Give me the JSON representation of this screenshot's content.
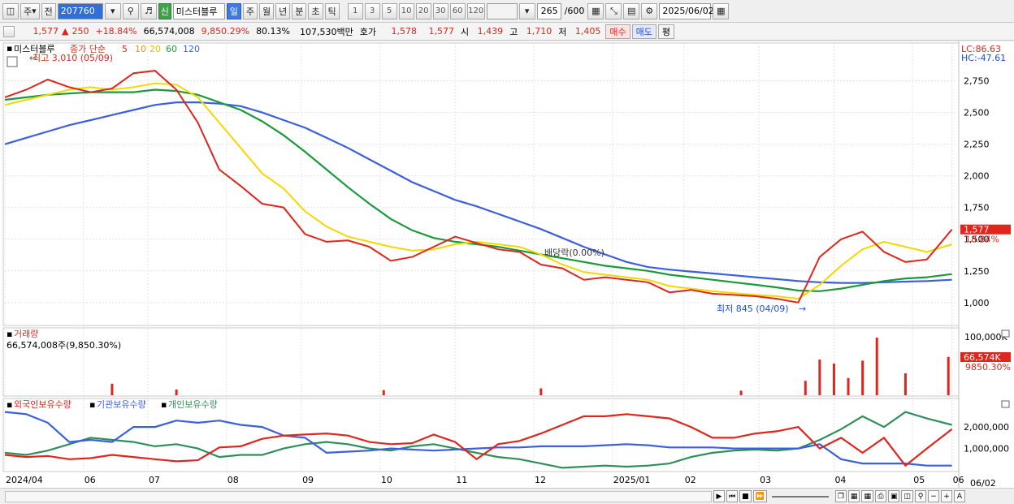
{
  "toolbar": {
    "period_label": "주",
    "prev_label": "전",
    "code": "207760",
    "new_badge": "신",
    "stock_name": "미스터블루",
    "periods": [
      "일",
      "주",
      "월",
      "년",
      "분",
      "초",
      "틱"
    ],
    "active_period": "일",
    "intervals": [
      "1",
      "3",
      "5",
      "10",
      "20",
      "30",
      "60",
      "120"
    ],
    "count": "265",
    "total": "/600",
    "date": "2025/06/02"
  },
  "quote": {
    "price": "1,577",
    "change": "250",
    "rate": "+18.84%",
    "volume": "66,574,008",
    "vol_rate": "9,850.29%",
    "turnover": "80.13%",
    "amount": "107,530백만",
    "bid_label": "호가",
    "bid1": "1,578",
    "bid2": "1,577",
    "open_label": "시",
    "open": "1,439",
    "high_label": "고",
    "high": "1,710",
    "low_label": "저",
    "low": "1,405",
    "buy_label": "매수",
    "sell_label": "매도",
    "avg_label": "평"
  },
  "chart_data": {
    "type": "line",
    "price_panel": {
      "stock_label": "미스터블루",
      "ma_label": "종가 단순",
      "ma_periods": [
        "5",
        "10",
        "20",
        "60",
        "120"
      ],
      "ma_colors": [
        "#e0261c",
        "#f0901e",
        "#f5d800",
        "#1b9a3a",
        "#3b5fe0"
      ],
      "lc": "LC:86.63",
      "hc": "HC:-47.61",
      "high_annotation": "최고 3,010 (05/09)",
      "low_annotation": "최저 845 (04/09)",
      "dividend_annotation": "배당락(0.00%)",
      "last_price": "1,577",
      "last_rate": "18.84%",
      "yticks": [
        "2,750",
        "2,500",
        "2,250",
        "2,000",
        "1,750",
        "1,500",
        "1,250",
        "1,000"
      ],
      "ytick_values": [
        2750,
        2500,
        2250,
        2000,
        1750,
        1500,
        1250,
        1000
      ],
      "ylim": [
        845,
        3010
      ],
      "x": [
        0,
        6,
        12,
        18,
        24,
        30,
        36,
        42,
        48,
        54,
        60,
        66,
        72,
        78,
        84,
        90,
        96,
        102,
        108,
        114,
        120,
        126,
        132,
        138,
        144,
        150,
        156,
        162,
        168,
        174,
        180,
        186,
        192,
        198,
        204,
        210,
        216,
        222,
        228,
        234,
        240,
        246,
        252,
        258,
        265
      ],
      "close": [
        2620,
        2680,
        2760,
        2700,
        2660,
        2690,
        2810,
        2830,
        2680,
        2420,
        2050,
        1920,
        1780,
        1750,
        1540,
        1480,
        1490,
        1440,
        1330,
        1360,
        1440,
        1520,
        1470,
        1420,
        1400,
        1300,
        1270,
        1180,
        1200,
        1180,
        1160,
        1080,
        1100,
        1070,
        1060,
        1050,
        1030,
        1000,
        1360,
        1500,
        1560,
        1400,
        1320,
        1340,
        1577
      ],
      "ma20": [
        2560,
        2600,
        2640,
        2680,
        2700,
        2680,
        2700,
        2730,
        2720,
        2620,
        2420,
        2220,
        2020,
        1900,
        1720,
        1600,
        1520,
        1480,
        1440,
        1410,
        1420,
        1460,
        1480,
        1460,
        1440,
        1380,
        1300,
        1240,
        1220,
        1200,
        1180,
        1130,
        1110,
        1090,
        1075,
        1060,
        1050,
        1030,
        1140,
        1290,
        1420,
        1480,
        1440,
        1400,
        1460
      ],
      "ma60": [
        2600,
        2620,
        2640,
        2650,
        2660,
        2660,
        2660,
        2680,
        2670,
        2640,
        2580,
        2520,
        2430,
        2320,
        2190,
        2050,
        1910,
        1780,
        1660,
        1570,
        1510,
        1480,
        1460,
        1440,
        1410,
        1380,
        1350,
        1320,
        1290,
        1270,
        1250,
        1220,
        1200,
        1180,
        1160,
        1140,
        1120,
        1095,
        1090,
        1110,
        1140,
        1170,
        1190,
        1200,
        1225
      ],
      "ma120": [
        2250,
        2300,
        2350,
        2400,
        2440,
        2480,
        2520,
        2560,
        2580,
        2580,
        2570,
        2550,
        2500,
        2440,
        2380,
        2300,
        2220,
        2130,
        2040,
        1950,
        1880,
        1810,
        1760,
        1700,
        1640,
        1580,
        1510,
        1440,
        1380,
        1320,
        1280,
        1260,
        1245,
        1230,
        1215,
        1200,
        1185,
        1170,
        1160,
        1155,
        1155,
        1160,
        1165,
        1170,
        1180
      ]
    },
    "volume_panel": {
      "title": "거래량",
      "value_label": "66,574,008주(9,850.30%)",
      "ytick": "100,000K",
      "last_value": "66,574K",
      "last_rate": "9850.30%",
      "ylim": [
        0,
        100000
      ],
      "bars": [
        {
          "x": 30,
          "v": 20000
        },
        {
          "x": 48,
          "v": 10000
        },
        {
          "x": 106,
          "v": 9000
        },
        {
          "x": 150,
          "v": 12000
        },
        {
          "x": 206,
          "v": 8000
        },
        {
          "x": 224,
          "v": 25000
        },
        {
          "x": 228,
          "v": 62000
        },
        {
          "x": 232,
          "v": 55000
        },
        {
          "x": 236,
          "v": 30000
        },
        {
          "x": 240,
          "v": 60000
        },
        {
          "x": 244,
          "v": 100000
        },
        {
          "x": 252,
          "v": 38000
        },
        {
          "x": 264,
          "v": 66574
        }
      ]
    },
    "holdings_panel": {
      "legend": [
        "외국인보유수량",
        "기관보유수량",
        "개인보유수량"
      ],
      "legend_colors": [
        "#e0261c",
        "#3b5fe0",
        "#2f8f5a"
      ],
      "yticks": [
        "2,000,000",
        "1,000,000"
      ],
      "ytick_values": [
        2000000,
        1000000
      ],
      "ylim": [
        0,
        2800000
      ],
      "x": [
        0,
        6,
        12,
        18,
        24,
        30,
        36,
        42,
        48,
        54,
        60,
        66,
        72,
        78,
        84,
        90,
        96,
        102,
        108,
        114,
        120,
        126,
        132,
        138,
        144,
        150,
        156,
        162,
        168,
        174,
        180,
        186,
        192,
        198,
        204,
        210,
        216,
        222,
        228,
        234,
        240,
        246,
        252,
        258,
        265
      ],
      "foreign": [
        700,
        600,
        650,
        500,
        550,
        700,
        600,
        500,
        400,
        450,
        1050,
        1100,
        1450,
        1600,
        1650,
        1700,
        1600,
        1300,
        1200,
        1250,
        1650,
        1300,
        500,
        1200,
        1350,
        1700,
        2100,
        2500,
        2500,
        2600,
        2500,
        2400,
        2000,
        1500,
        1500,
        1700,
        1800,
        2000,
        1000,
        1500,
        800,
        1500,
        200,
        1000,
        1900
      ],
      "institution": [
        2700,
        2600,
        2200,
        1300,
        1400,
        1300,
        2000,
        2000,
        2300,
        2200,
        2300,
        2100,
        2000,
        1600,
        1500,
        800,
        850,
        900,
        1000,
        950,
        900,
        950,
        1000,
        1050,
        1050,
        1100,
        1100,
        1100,
        1150,
        1200,
        1150,
        1050,
        1050,
        1050,
        1000,
        1000,
        1000,
        1000,
        1200,
        500,
        300,
        300,
        300,
        200,
        200
      ],
      "individual": [
        800,
        700,
        900,
        1200,
        1500,
        1400,
        1300,
        1100,
        1200,
        1000,
        600,
        700,
        700,
        1000,
        1200,
        1300,
        1200,
        1000,
        900,
        1100,
        1200,
        1000,
        800,
        600,
        500,
        300,
        100,
        150,
        200,
        150,
        200,
        300,
        600,
        800,
        900,
        950,
        900,
        1000,
        1400,
        1900,
        2500,
        2000,
        2700,
        2400,
        2100
      ]
    },
    "xticks": [
      "2024/04",
      "06",
      "07",
      "08",
      "09",
      "10",
      "11",
      "12",
      "2025/01",
      "02",
      "03",
      "04",
      "05",
      "06"
    ],
    "xtick_positions": [
      0,
      22,
      40,
      62,
      83,
      105,
      126,
      148,
      170,
      190,
      211,
      232,
      254,
      265
    ],
    "x_end_label": "06/02",
    "xlim": [
      0,
      266
    ]
  }
}
